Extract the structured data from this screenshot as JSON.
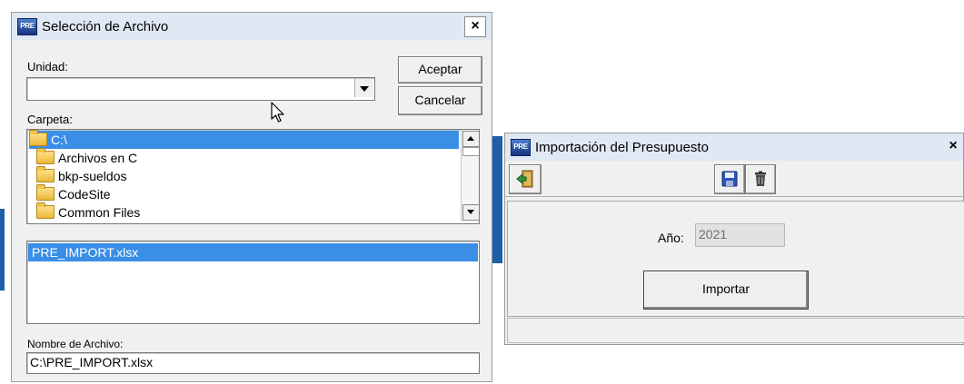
{
  "file_dialog": {
    "title": "Selección de Archivo",
    "app_icon": "PRE",
    "close_label": "×",
    "drive_label": "Unidad:",
    "drive_value": "",
    "accept_label": "Aceptar",
    "cancel_label": "Cancelar",
    "folder_label": "Carpeta:",
    "folders": [
      {
        "name": "C:\\",
        "icon": "open-folder-icon",
        "selected": true
      },
      {
        "name": "Archivos en C",
        "icon": "folder-icon",
        "selected": false
      },
      {
        "name": "bkp-sueldos",
        "icon": "folder-icon",
        "selected": false
      },
      {
        "name": "CodeSite",
        "icon": "folder-icon",
        "selected": false
      },
      {
        "name": "Common Files",
        "icon": "folder-icon",
        "selected": false
      }
    ],
    "files": [
      {
        "name": "PRE_IMPORT.xlsx",
        "selected": true
      }
    ],
    "filename_label": "Nombre de Archivo:",
    "filename_value": "C:\\PRE_IMPORT.xlsx"
  },
  "import_window": {
    "title": "Importación del Presupuesto",
    "app_icon": "PRE",
    "close_label": "×",
    "toolbar": {
      "exit_icon": "exit-door-icon",
      "save_icon": "floppy-disk-icon",
      "delete_icon": "trash-icon"
    },
    "year_label": "Año:",
    "year_value": "2021",
    "import_label": "Importar",
    "status_text": ""
  },
  "colors": {
    "selection": "#3a8ee6",
    "titlebar": "#dfe8f3",
    "window_bg": "#f0f0f0",
    "desktop_strip": "#1f5fa8"
  }
}
